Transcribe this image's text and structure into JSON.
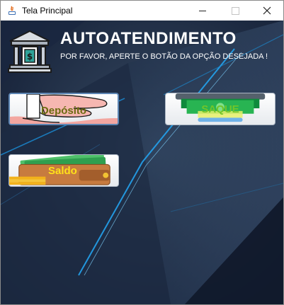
{
  "window": {
    "title": "Tela Principal"
  },
  "header": {
    "title": "AUTOATENDIMENTO",
    "subtitle": "POR FAVOR, APERTE O BOTÃO DA OPÇÃO DESEJADA !"
  },
  "buttons": {
    "deposito": "Depósito",
    "saque": "SAQUE",
    "saldo": "Saldo"
  }
}
